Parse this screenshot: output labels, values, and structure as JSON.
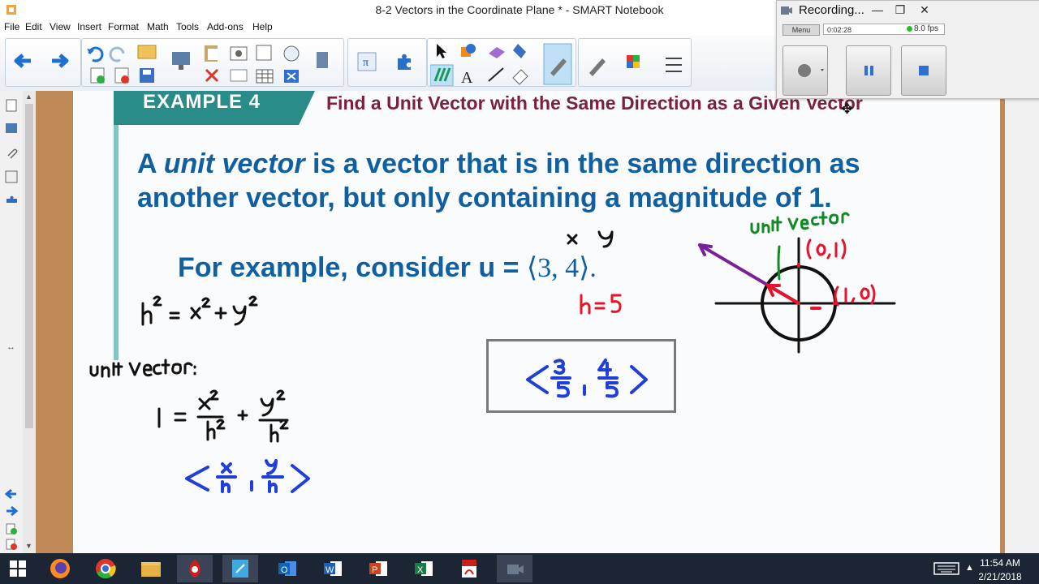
{
  "window": {
    "title": "8-2 Vectors in the Coordinate Plane * - SMART Notebook",
    "minimize": "—",
    "maximize": "❐",
    "close": "✕"
  },
  "menu": [
    "File",
    "Edit",
    "View",
    "Insert",
    "Format",
    "Math",
    "Tools",
    "Add-ons",
    "Help"
  ],
  "recorder": {
    "title": "Recording...",
    "menu_label": "Menu",
    "elapsed": "0:02:28",
    "fps": "8.0 fps",
    "record_color": "#7a7a7a",
    "pause_color": "#2f6fd1",
    "stop_color": "#2f6fd1"
  },
  "slide": {
    "banner": "EXAMPLE 4",
    "heading": "Find a Unit Vector with the Same Direction as a Given Vector",
    "def_part1": "A ",
    "def_italic": "unit vector",
    "def_part2": " is a vector that is in the same direction as",
    "def_line2": "another vector, but only containing a magnitude of 1.",
    "example_text": "For example, consider u = ",
    "example_vector": "⟨3, 4⟩."
  },
  "colors": {
    "banner": "#2a8c89",
    "heading": "#7a1f3c",
    "body_text": "#0f5fa1",
    "ink_black": "#111111",
    "ink_blue": "#1f3fd6",
    "ink_red": "#e8132b",
    "ink_green": "#138a25",
    "ink_purple": "#7b1f9a"
  },
  "taskbar": {
    "apps": [
      "windows-start",
      "firefox",
      "chrome",
      "file-explorer",
      "smart-recorder",
      "smart-notebook",
      "outlook",
      "word",
      "powerpoint",
      "excel",
      "pdf",
      "video-recorder"
    ],
    "time": "11:54 AM",
    "date": "2/21/2018"
  }
}
